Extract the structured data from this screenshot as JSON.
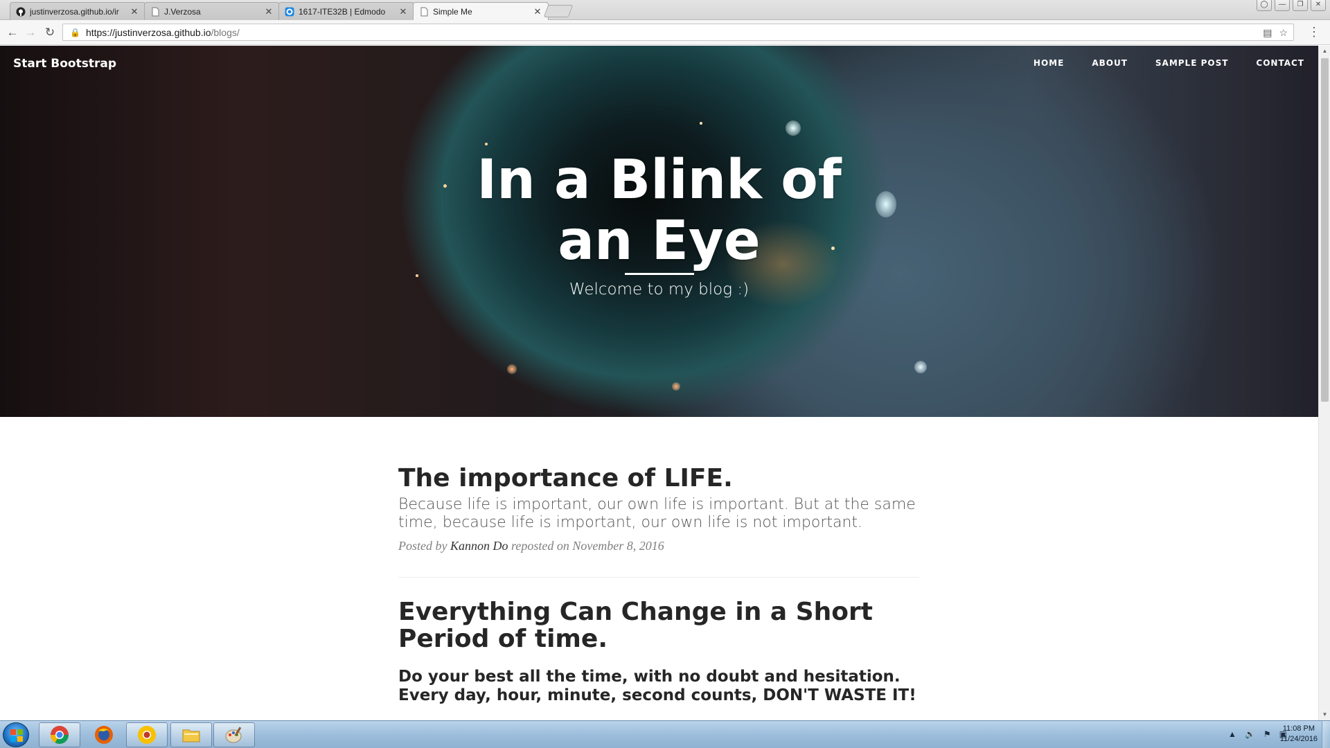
{
  "browser": {
    "tabs": [
      {
        "title": "justinverzosa.github.io/ir",
        "icon": "github-icon"
      },
      {
        "title": "J.Verzosa",
        "icon": "document-icon"
      },
      {
        "title": "1617-ITE32B | Edmodo",
        "icon": "edmodo-icon"
      },
      {
        "title": "Simple Me",
        "icon": "document-icon",
        "active": true
      }
    ],
    "url_host": "https://justinverzosa.github.io",
    "url_path": "/blogs/"
  },
  "site": {
    "brand": "Start Bootstrap",
    "nav": [
      "HOME",
      "ABOUT",
      "SAMPLE POST",
      "CONTACT"
    ],
    "heading": "In a Blink of an Eye",
    "subheading": "Welcome to my blog :)"
  },
  "posts": [
    {
      "title": "The importance of LIFE.",
      "subtitle": "Because life is important, our own life is important. But at the same time, because life is important, our own life is not important.",
      "meta_prefix": "Posted by",
      "author": "Kannon Do",
      "meta_suffix": "reposted on November 8, 2016"
    },
    {
      "title": "Everything Can Change in a Short Period of time.",
      "subtitle": "Do your best all the time, with no doubt and hesitation. Every day, hour, minute, second counts, DON'T WASTE IT!"
    }
  ],
  "taskbar": {
    "time": "11:08 PM",
    "date": "11/24/2016",
    "apps": [
      "chrome-icon",
      "firefox-icon",
      "chrome-canary-icon",
      "file-explorer-icon",
      "paint-icon"
    ]
  },
  "colors": {
    "accent_link": "#0b8043",
    "heading_text": "#262626",
    "meta_text": "#808080"
  }
}
